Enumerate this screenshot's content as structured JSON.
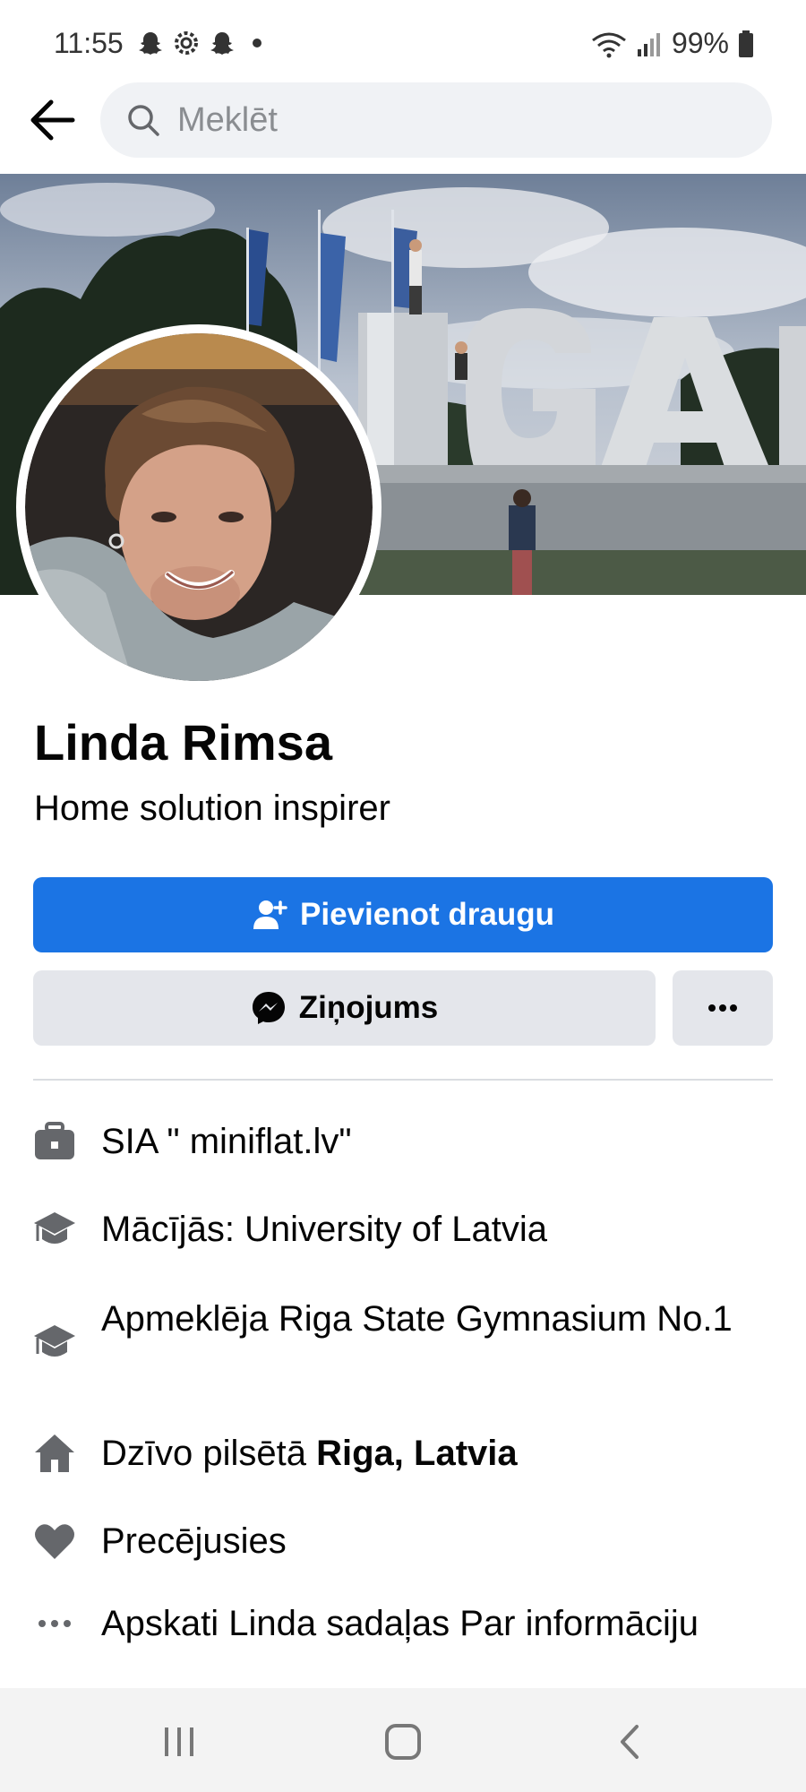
{
  "status_bar": {
    "time": "11:55",
    "battery": "99%"
  },
  "search": {
    "placeholder": "Meklēt"
  },
  "profile": {
    "name": "Linda Rimsa",
    "bio": "Home solution inspirer"
  },
  "actions": {
    "add_friend": "Pievienot draugu",
    "message": "Ziņojums"
  },
  "details": {
    "work": "SIA \" miniflat.lv\"",
    "study": "Mācījās: University of Latvia",
    "school": "Apmeklēja Riga State Gymnasium No.1",
    "lives_prefix": "Dzīvo pilsētā ",
    "lives_city": "Riga, Latvia",
    "relationship": "Precējusies",
    "see_about": "Apskati Linda sadaļas Par informāciju"
  },
  "colors": {
    "primary": "#1b74e4",
    "secondary_bg": "#e4e6eb",
    "icon_gray": "#65676b"
  }
}
